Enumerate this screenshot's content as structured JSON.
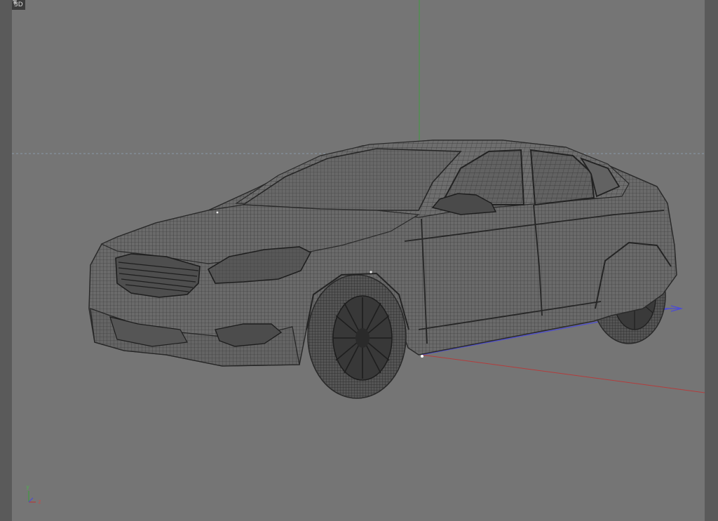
{
  "viewport": {
    "view_mode_label": "3D",
    "view_mode_icon": "pin-icon",
    "background_color": "#757575",
    "frame_color": "#5a5a5a"
  },
  "axes": {
    "x_color": "#b33c3c",
    "y_color": "#3f9a3f",
    "z_color": "#4b4bd6",
    "horizon_color": "#8fa2b3"
  },
  "gizmo": {
    "y_label": "y",
    "z_label": "z"
  },
  "model": {
    "type": "car-wireframe",
    "wire_color": "#2e2e2e",
    "body_color": "#6c6c6c"
  }
}
